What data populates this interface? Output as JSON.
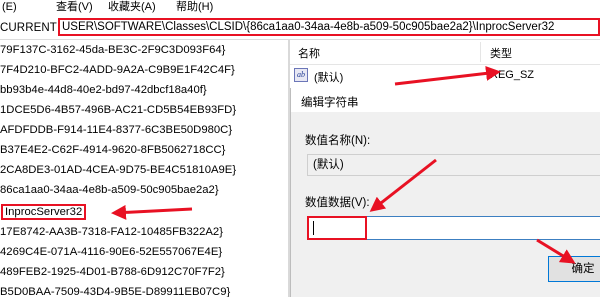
{
  "menubar": {
    "items": [
      "(E)",
      "查看(V)",
      "收藏夹(A)",
      "帮助(H)"
    ]
  },
  "address": {
    "prefix": "CURRENT",
    "path": "USER\\SOFTWARE\\Classes\\CLSID\\{86ca1aa0-34aa-4e8b-a509-50c905bae2a2}\\InprocServer32"
  },
  "tree": {
    "items": [
      "79F137C-3162-45da-BE3C-2F9C3D093F64}",
      "7F4D210-BFC2-4ADD-9A2A-C9B9E1F42C4F}",
      "bb93b4e-44d8-40e2-bd97-42dbcf18a40f}",
      "1DCE5D6-4B57-496B-AC21-CD5B54EB93FD}",
      "AFDFDDB-F914-11E4-8377-6C3BE50D980C}",
      "B37E4E2-C62F-4914-9620-8FB5062718CC}",
      "2CA8DE3-01AD-4CEA-9D75-BE4C51810A9E}",
      "86ca1aa0-34aa-4e8b-a509-50c905bae2a2}",
      "InprocServer32",
      "17E8742-AA3B-7318-FA12-10485FB322A2}",
      "4269C4E-071A-4116-90E6-52E557067E4E}",
      "489FEB2-1925-4D01-B788-6D912C70F7F2}",
      "B5D0BAA-7509-43D4-9B5E-D89911EB07C9}"
    ]
  },
  "list": {
    "col_name": "名称",
    "col_type": "类型",
    "row_icon": "ab",
    "row_name": "(默认)",
    "row_type": "REG_SZ"
  },
  "dialog": {
    "title": "编辑字符串",
    "name_label": "数值名称(N):",
    "name_value": "(默认)",
    "data_label": "数值数据(V):",
    "data_value": "",
    "ok_label": "确定"
  },
  "colors": {
    "annotation_red": "#e81123",
    "focus_blue": "#0078d7"
  }
}
